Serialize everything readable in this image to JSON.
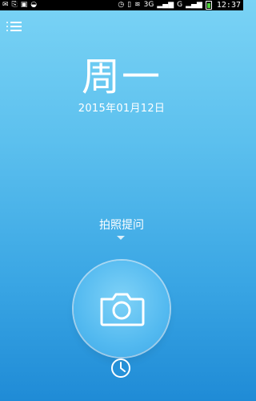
{
  "status_bar": {
    "time": "12:37",
    "network_label": "3G",
    "network_label2": "G"
  },
  "main": {
    "weekday": "周一",
    "date": "2015年01月12日",
    "hint": "拍照提问"
  },
  "icons": {
    "menu": "list-menu-icon",
    "camera": "camera-icon",
    "history": "clock-icon"
  },
  "colors": {
    "bg_top": "#7ad3f5",
    "bg_bottom": "#1f8bd6",
    "camera_circle": "#54baf0"
  }
}
